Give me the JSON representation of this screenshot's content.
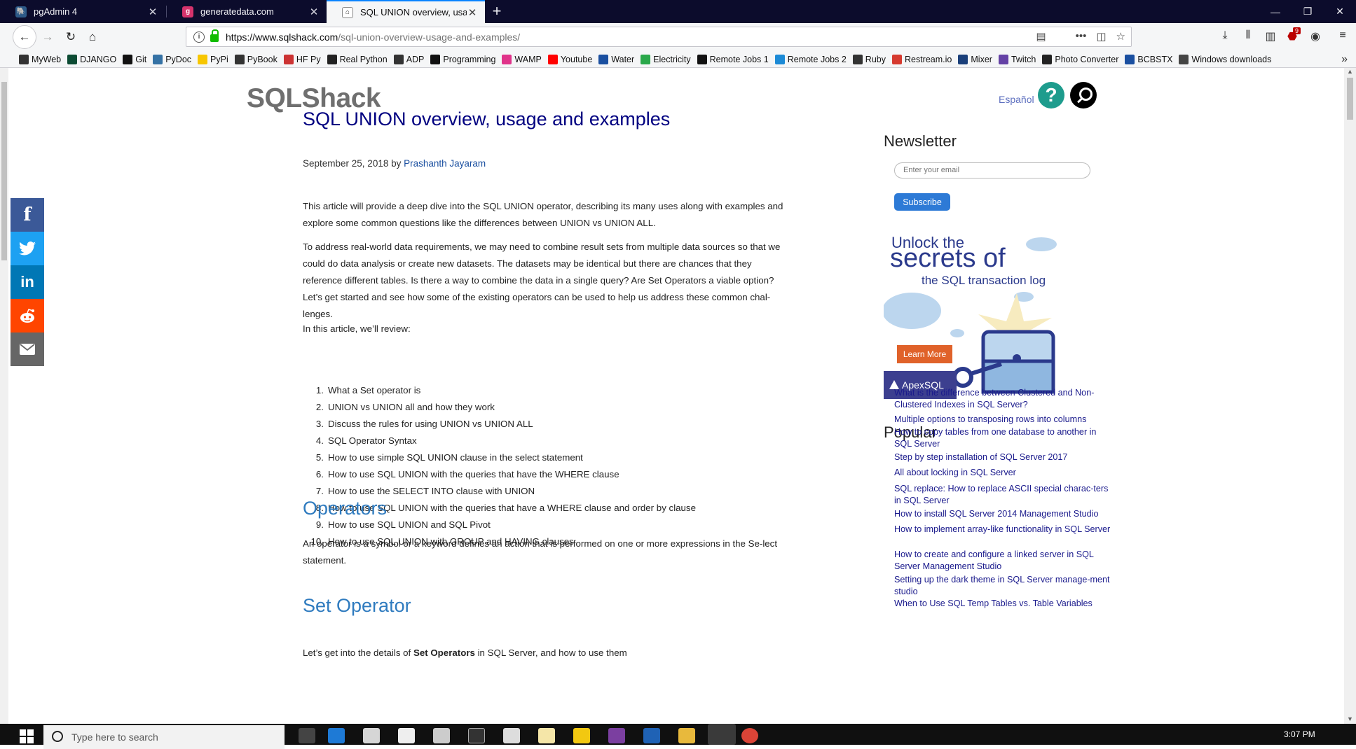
{
  "browser": {
    "tabs": [
      {
        "title": "pgAdmin 4",
        "icon": "pgadmin-elephant-icon",
        "active": false
      },
      {
        "title": "generatedata.com",
        "icon": "generatedata-icon",
        "active": false
      },
      {
        "title": "SQL UNION overview, usage an",
        "icon": "sqlshack-icon",
        "active": true
      }
    ],
    "new_tab_symbol": "+",
    "window_controls": {
      "minimize": "—",
      "restore": "❐",
      "close": "✕"
    },
    "url": {
      "host": "https://www.sqlshack.com",
      "path": "/sql-union-overview-usage-and-examples/"
    },
    "toolbar_badge": "9",
    "bookmarks": [
      {
        "label": "MyWeb",
        "icon": "globe-icon",
        "color": "#333333"
      },
      {
        "label": "DJANGO",
        "icon": "django-icon",
        "color": "#0c4b33"
      },
      {
        "label": "Git",
        "icon": "github-icon",
        "color": "#111111"
      },
      {
        "label": "PyDoc",
        "icon": "python-icon",
        "color": "#3572a5"
      },
      {
        "label": "PyPi",
        "icon": "pypi-icon",
        "color": "#f7c600"
      },
      {
        "label": "PyBook",
        "icon": "globe-icon",
        "color": "#333333"
      },
      {
        "label": "HF Py",
        "icon": "humble-icon",
        "color": "#cc3333"
      },
      {
        "label": "Real Python",
        "icon": "realpython-icon",
        "color": "#222222"
      },
      {
        "label": "ADP",
        "icon": "globe-icon",
        "color": "#333333"
      },
      {
        "label": "Programming",
        "icon": "terminal-icon",
        "color": "#111111"
      },
      {
        "label": "WAMP",
        "icon": "wamp-icon",
        "color": "#e0338a"
      },
      {
        "label": "Youtube",
        "icon": "youtube-icon",
        "color": "#ff0000"
      },
      {
        "label": "Water",
        "icon": "water-icon",
        "color": "#1a4fa0"
      },
      {
        "label": "Electricity",
        "icon": "electricity-icon",
        "color": "#2aa84a"
      },
      {
        "label": "Remote Jobs 1",
        "icon": "wwr-icon",
        "color": "#111111"
      },
      {
        "label": "Remote Jobs 2",
        "icon": "remote-icon",
        "color": "#1c8ad6"
      },
      {
        "label": "Ruby",
        "icon": "globe-icon",
        "color": "#333333"
      },
      {
        "label": "Restream.io",
        "icon": "restream-icon",
        "color": "#d63a2f"
      },
      {
        "label": "Mixer",
        "icon": "mixer-icon",
        "color": "#1a3f7a"
      },
      {
        "label": "Twitch",
        "icon": "twitch-icon",
        "color": "#6441a5"
      },
      {
        "label": "Photo Converter",
        "icon": "photo-icon",
        "color": "#222222"
      },
      {
        "label": "BCBSTX",
        "icon": "bcbs-icon",
        "color": "#1a4fa0"
      },
      {
        "label": "Windows downloads",
        "icon": "folder-icon",
        "color": "#444444"
      }
    ]
  },
  "site": {
    "logo": "SQLShack",
    "language_link": "Español",
    "help_symbol": "?"
  },
  "article": {
    "title": "SQL UNION overview, usage and examples",
    "date": "September 25, 2018 by ",
    "author": "Prashanth Jayaram",
    "intro": "This article will provide a deep dive into the SQL UNION operator, describing its many uses along with examples and explore some common questions like the differences between UNION vs UNION ALL.",
    "para2": "To address real-world data requirements, we may need to combine result sets from multiple data sources so that we could do data analysis or create new datasets. The datasets may be identical but there are chances that they reference different tables. Is there a way to combine the data in a single query? Are Set Operators a viable option? Let’s get started and see how some of the existing operators can be used to help us address these common chal-lenges.",
    "review_lead": "In this article, we’ll review:",
    "toc": [
      "What a Set operator is",
      "UNION vs UNION all and how they work",
      "Discuss the rules for using UNION vs UNION ALL",
      "SQL Operator Syntax",
      "How to use simple SQL UNION clause in the select statement",
      "How to use SQL UNION with the queries that have the WHERE clause",
      "How to use the SELECT INTO clause with UNION",
      "How to use SQL UNION with the queries that have a WHERE clause and order by clause",
      "How to use SQL UNION and SQL Pivot",
      "How to use SQL UNION with GROUP and HAVING clauses"
    ],
    "h_operators": "Operators",
    "operators_text": "An operator is a symbol or a keyword defines an action that is performed on one or more expressions in the Se-lect statement.",
    "h_set_operator": "Set Operator",
    "set_text_pre": "Let’s get into the details of ",
    "set_text_bold": "Set Operators",
    "set_text_post": " in SQL Server, and how to use them"
  },
  "sidebar": {
    "newsletter_title": "Newsletter",
    "email_placeholder": "Enter your email",
    "subscribe_label": "Subscribe",
    "ad": {
      "line1": "Unlock the",
      "line2": "secrets of",
      "line3": "the SQL transaction log",
      "button": "Learn More",
      "brand": "ApexSQL"
    },
    "popular_title": "Popular",
    "popular": [
      "What is the difference between Clustered and Non-Clustered Indexes in SQL Server?",
      "Multiple options to transposing rows into columns",
      "How to copy tables from one database to another in SQL Server",
      "Step by step installation of SQL Server 2017",
      "All about locking in SQL Server",
      "SQL replace: How to replace ASCII special charac-ters in SQL Server",
      "How to install SQL Server 2014 Management Studio",
      "How to implement array-like functionality in SQL Server",
      "How to create and configure a linked server in SQL Server Management Studio",
      "Setting up the dark theme in SQL Server manage-ment studio",
      "When to Use SQL Temp Tables vs. Table Variables"
    ]
  },
  "taskbar": {
    "search_placeholder": "Type here to search",
    "clock": "3:07 PM"
  }
}
